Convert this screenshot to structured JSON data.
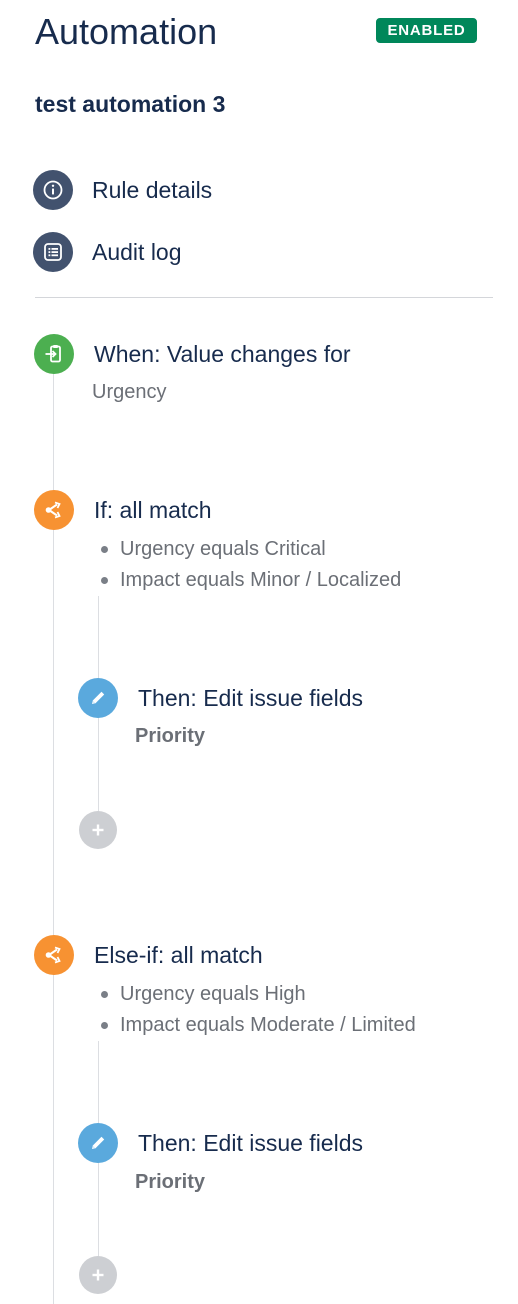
{
  "header": {
    "title": "Automation",
    "status_badge": "ENABLED",
    "rule_name": "test automation 3"
  },
  "menu": {
    "rule_details": "Rule details",
    "audit_log": "Audit log"
  },
  "trigger": {
    "title": "When: Value changes for",
    "field": "Urgency",
    "icon": "trigger-icon",
    "color": "#4caf50"
  },
  "branches": [
    {
      "title": "If: all match",
      "conditions": [
        "Urgency equals Critical",
        "Impact equals Minor / Localized"
      ],
      "action": {
        "title": "Then: Edit issue fields",
        "field": "Priority"
      }
    },
    {
      "title": "Else-if: all match",
      "conditions": [
        "Urgency equals High",
        "Impact equals Moderate / Limited"
      ],
      "action": {
        "title": "Then: Edit issue fields",
        "field": "Priority"
      }
    }
  ],
  "colors": {
    "text": "#172b4d",
    "badge": "#00875a",
    "menu_icon": "#42526e",
    "trigger": "#4caf50",
    "condition": "#f79232",
    "action": "#5aa9dd",
    "add": "#cdcfd3"
  }
}
